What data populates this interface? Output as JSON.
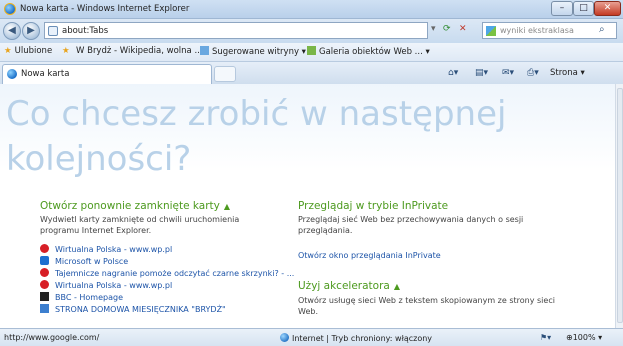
{
  "window": {
    "title": "Nowa karta - Windows Internet Explorer",
    "controls": {
      "minimize": "–",
      "maximize": "□",
      "close": "✕"
    }
  },
  "navigation": {
    "back_icon": "arrow-left-icon",
    "forward_icon": "arrow-right-icon",
    "address_value": "about:Tabs",
    "search_placeholder": "wyniki ekstraklasa"
  },
  "favorites_bar": {
    "favorites_label": "Ulubione",
    "items": [
      "W Brydż - Wikipedia, wolna ...",
      "Sugerowane witryny ▾",
      "Galeria obiektów Web ... ▾"
    ]
  },
  "tabs": {
    "active_tab": "Nowa karta"
  },
  "command_bar": {
    "strona": "Strona ▾"
  },
  "content": {
    "headline": "Co chcesz zrobić w następnej kolejności?",
    "reopen": {
      "title": "Otwórz ponownie zamknięte karty",
      "caret": "▲",
      "text": "Wydwietl karty zamknięte od chwili uruchomienia programu Internet Explorer."
    },
    "recent_items": [
      {
        "icon": "wp",
        "label": "Wirtualna Polska - www.wp.pl"
      },
      {
        "icon": "ms",
        "label": "Microsoft w Polsce"
      },
      {
        "icon": "wp",
        "label": "Tajemnicze nagranie pomoże odczytać czarne skrzynki? - ..."
      },
      {
        "icon": "wp",
        "label": "Wirtualna Polska - www.wp.pl"
      },
      {
        "icon": "bbc",
        "label": "BBC - Homepage"
      },
      {
        "icon": "st",
        "label": "STRONA DOMOWA MIESIĘCZNIKA \"BRYDŻ\""
      }
    ],
    "inprivate": {
      "title": "Przeglądaj w trybie InPrivate",
      "text": "Przeglądaj sieć Web bez przechowywania danych o sesji przeglądania.",
      "link": "Otwórz okno przeglądania InPrivate"
    },
    "accelerator": {
      "title": "Użyj akceleratora",
      "caret": "▲",
      "text": "Otwórz usługę sieci Web z tekstem skopiowanym ze strony sieci Web."
    }
  },
  "status_bar": {
    "url": "http://www.google.com/",
    "zone": "Internet | Tryb chroniony: włączony",
    "zoom": "100%"
  }
}
